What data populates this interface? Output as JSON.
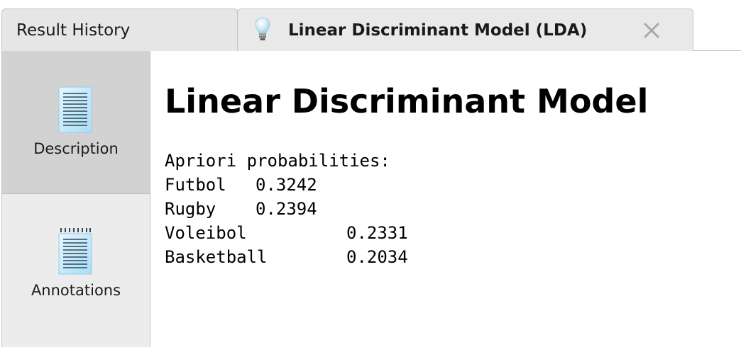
{
  "tabs": [
    {
      "label": "Result History",
      "active": false
    },
    {
      "label": "Linear Discriminant Model (LDA)",
      "active": true,
      "icon": "lightbulb-icon",
      "close_icon": "close-icon"
    }
  ],
  "sidebar": {
    "items": [
      {
        "label": "Description",
        "icon": "document-icon",
        "selected": true
      },
      {
        "label": "Annotations",
        "icon": "notepad-icon",
        "selected": false
      }
    ]
  },
  "main": {
    "title": "Linear Discriminant Model",
    "apriori_heading": "Apriori probabilities:",
    "probabilities": [
      {
        "name": "Futbol",
        "value": "0.3242"
      },
      {
        "name": "Rugby",
        "value": "0.2394"
      },
      {
        "name": "Voleibol",
        "value": "0.2331"
      },
      {
        "name": "Basketball",
        "value": "0.2034"
      }
    ]
  },
  "colors": {
    "active_tab_bg": "#e9e9e9",
    "sidebar_selected_bg": "#d2d2d2",
    "sidebar_bg": "#ececec",
    "icon_blue": "#bfe6fb"
  }
}
